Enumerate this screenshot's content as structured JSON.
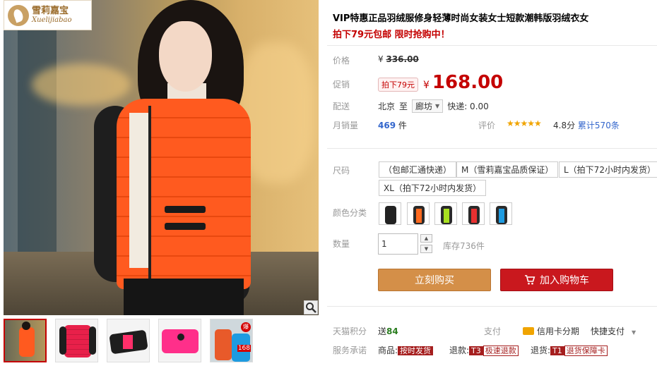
{
  "brand": {
    "name_cn": "雪莉嘉宝",
    "name_en": "Xuelijiabao"
  },
  "product": {
    "title": "VIP特惠正品羽绒服修身轻薄时尚女装女士短款潮韩版羽绒衣女",
    "subtitle": "拍下79元包邮 限时抢购中！"
  },
  "price": {
    "label": "价格",
    "currency": "¥",
    "original": "336.00"
  },
  "promo": {
    "label": "促销",
    "tag": "拍下79元",
    "currency": "¥",
    "value": "168.00"
  },
  "shipping": {
    "label": "配送",
    "from": "北京",
    "to_word": "至",
    "destination": "廊坊",
    "fee": "快递: 0.00"
  },
  "sales": {
    "label": "月销量",
    "count": "469",
    "unit": "件"
  },
  "rating": {
    "label": "评价",
    "stars": "★★★★★",
    "stars_value": 4.8,
    "score": "4.8分",
    "total": "累计570条"
  },
  "size": {
    "label": "尺码",
    "options": [
      "（包邮汇通快递）",
      "M（雪莉嘉宝品质保证）",
      "L（拍下72小时内发货）",
      "XL（拍下72小时内发货）"
    ]
  },
  "color": {
    "label": "颜色分类",
    "swatches": [
      "black",
      "orange",
      "lime",
      "red",
      "blue"
    ]
  },
  "quantity": {
    "label": "数量",
    "value": "1",
    "stock": "库存736件"
  },
  "actions": {
    "buy_now": "立刻购买",
    "add_cart": "加入购物车"
  },
  "footer": {
    "points_label": "天猫积分",
    "points_prefix": "送",
    "points_value": "84",
    "pay_label": "支付",
    "pay_card": "信用卡分期",
    "pay_fast": "快捷支付",
    "service_label": "服务承诺",
    "goods": "商品:",
    "goods_tag": "按时发货",
    "refund": "退款:",
    "refund_tag_code": "T3",
    "refund_tag": "极速退款",
    "return": "退货:",
    "return_tag_code": "T1",
    "return_tag": "退货保障卡"
  },
  "thumbnails": {
    "badge": "爆",
    "number": "168"
  },
  "colors": {
    "accent": "#c40000",
    "buy": "#d48f48",
    "cart": "#c9181e",
    "link": "#3366cc"
  }
}
